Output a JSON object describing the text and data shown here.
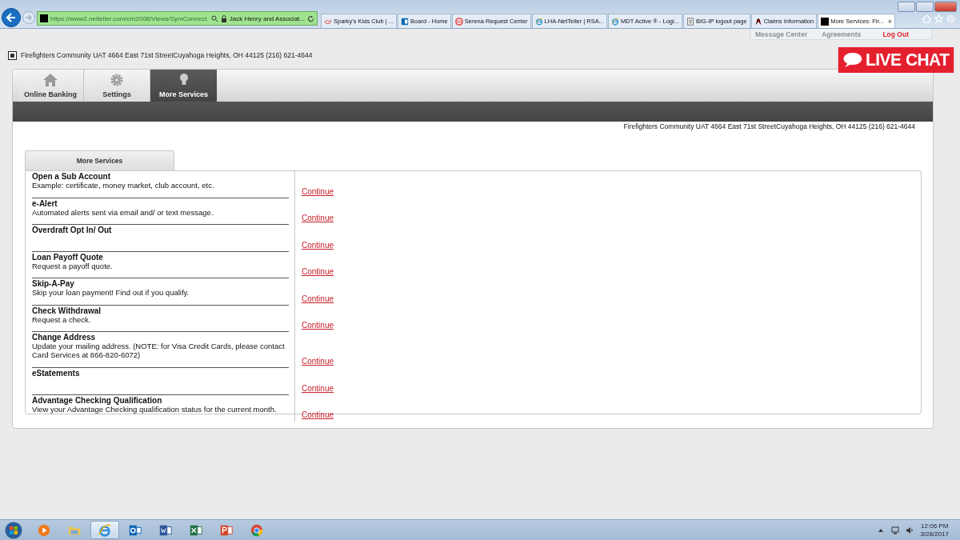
{
  "browser": {
    "url": "https://www2.netteller.com/cm2008/Views/SymConnect.",
    "site_identity": "Jack Henry and Associat...",
    "tabs": [
      {
        "kind": "sparky",
        "label": "Sparky's Kids Club | ...",
        "selected": false
      },
      {
        "kind": "sharepoint",
        "label": "Board - Home",
        "selected": false
      },
      {
        "kind": "serena",
        "label": "Serena Request Center",
        "selected": false
      },
      {
        "kind": "ie",
        "label": "LHA-NetTeller | RSA...",
        "selected": false
      },
      {
        "kind": "ie",
        "label": "MDT Active ® - Logi...",
        "selected": false
      },
      {
        "kind": "page",
        "label": "BIG-IP logout page",
        "selected": false
      },
      {
        "kind": "claims",
        "label": "Claims Information",
        "selected": false
      },
      {
        "kind": "black",
        "label": "More Services: Fir...",
        "selected": true,
        "close": "×"
      }
    ]
  },
  "top_links": [
    {
      "label": "Message Center",
      "kind": "plain"
    },
    {
      "label": "Agreements",
      "kind": "plain"
    },
    {
      "label": "Log Out",
      "kind": "alert"
    }
  ],
  "header": {
    "address": "Firefighters Community UAT 4664 East 71st StreetCuyahoga Heights, OH 44125 (216) 621-4644"
  },
  "live_chat": "LIVE CHAT",
  "nav_tabs": [
    {
      "kind": "home",
      "label": "Online Banking",
      "selected": false
    },
    {
      "kind": "gear",
      "label": "Settings",
      "selected": false
    },
    {
      "kind": "bulb",
      "label": "More Services",
      "selected": true
    }
  ],
  "address_line": "Firefighters Community UAT 4664 East 71st StreetCuyahoga Heights, OH 44125 (216) 621-4644",
  "section_tab": "More Services",
  "services": [
    {
      "name": "Open a Sub Account",
      "description": "Example: certificate, money market, club account, etc.",
      "link": "Continue"
    },
    {
      "name": "e-Alert",
      "description": "Automated alerts sent via email and/ or text message.",
      "link": "Continue"
    },
    {
      "name": "Overdraft Opt In/ Out",
      "link": "Continue"
    },
    {
      "name": "Loan Payoff Quote",
      "description": "Request a payoff quote.",
      "link": "Continue"
    },
    {
      "name": "Skip-A-Pay",
      "description": "Skip your loan payment! Find out if you qualify.",
      "link": "Continue"
    },
    {
      "name": "Check Withdrawal",
      "description": "Request a check.",
      "link": "Continue"
    },
    {
      "name": "Change Address",
      "description": "Update your mailing address. (NOTE: for Visa Credit Cards, please contact Card Services at 866-820-6072)",
      "link": "Continue"
    },
    {
      "name": "eStatements",
      "link": "Continue"
    },
    {
      "name": "Advantage Checking Qualification",
      "description": "View your Advantage Checking qualification status for the current month.",
      "link": "Continue"
    }
  ],
  "taskbar": {
    "apps": [
      {
        "kind": "media",
        "selected": false
      },
      {
        "kind": "folder",
        "selected": false
      },
      {
        "kind": "ie",
        "selected": true
      },
      {
        "kind": "outlook",
        "selected": false
      },
      {
        "kind": "word",
        "selected": false
      },
      {
        "kind": "excel",
        "selected": false
      },
      {
        "kind": "powerpoint",
        "selected": false
      },
      {
        "kind": "chrome",
        "selected": false
      }
    ],
    "time": "12:06 PM",
    "date": "3/28/2017"
  }
}
